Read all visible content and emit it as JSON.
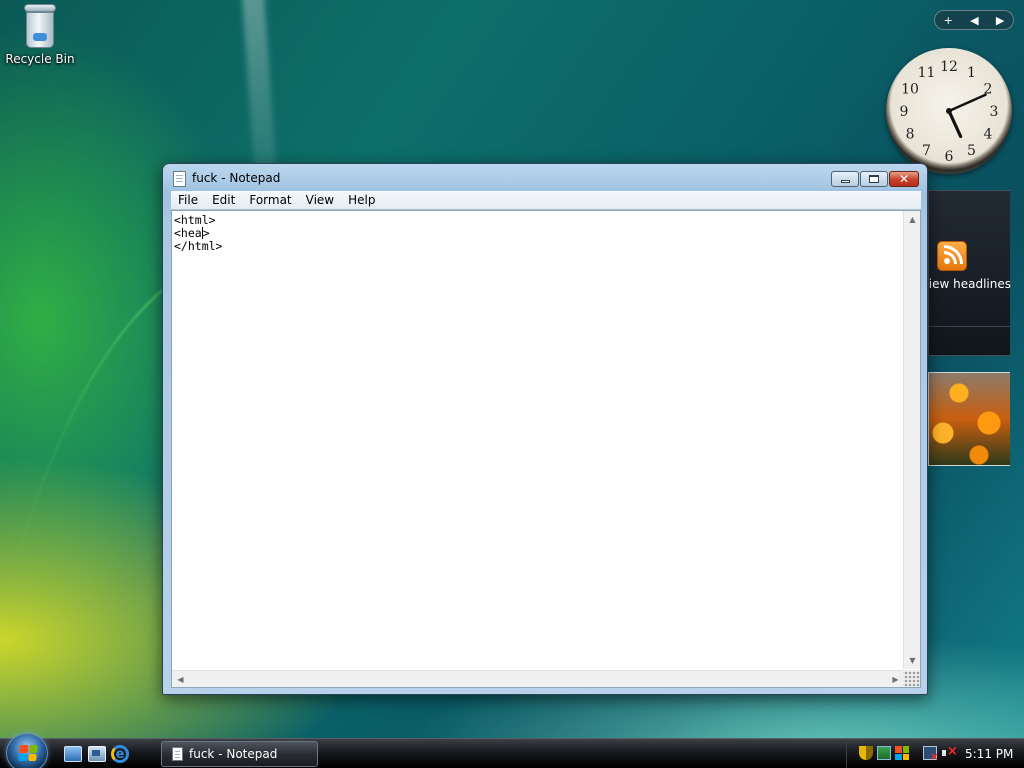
{
  "desktop": {
    "icons": [
      {
        "label": "Recycle Bin",
        "icon": "recycle-bin-icon"
      }
    ]
  },
  "sidebar": {
    "controls": {
      "add": "+",
      "prev": "◀",
      "next": "▶"
    },
    "clock": {
      "numerals": [
        "12",
        "1",
        "2",
        "3",
        "4",
        "5",
        "6",
        "7",
        "8",
        "9",
        "10",
        "11"
      ],
      "time": {
        "hour": 5,
        "minute": 11
      }
    },
    "feed_headlines": {
      "label": "View headlines",
      "icon": "rss-icon"
    },
    "slide_show": {
      "icon": "flower-photo"
    }
  },
  "window": {
    "title": "fuck - Notepad",
    "icon": "notepad-icon",
    "controls": {
      "close": "✕"
    },
    "menu": [
      "File",
      "Edit",
      "Format",
      "View",
      "Help"
    ],
    "content": {
      "lines": [
        "<html>",
        "<hea",
        "</html>"
      ],
      "caret_after": ">"
    },
    "scroll": {
      "up": "▲",
      "down": "▼",
      "left": "◀",
      "right": "▶"
    }
  },
  "taskbar": {
    "start": {
      "icon": "windows-start-orb"
    },
    "quick_launch": [
      "show-desktop-icon",
      "switch-windows-icon",
      "internet-explorer-icon"
    ],
    "ie_glyph": "e",
    "tasks": [
      {
        "label": "fuck - Notepad",
        "icon": "notepad-icon"
      }
    ],
    "tray": {
      "icons": [
        "shield-icon",
        "security-center-icon",
        "windows-update-icon",
        "network-disconnected-icon",
        "volume-muted-icon"
      ],
      "time": "5:11 PM"
    }
  },
  "colors": {
    "taskbar": "#17191c",
    "window_frame": "#9ec1e0",
    "close_button": "#c8402a",
    "rss_orange": "#f08c1c"
  }
}
